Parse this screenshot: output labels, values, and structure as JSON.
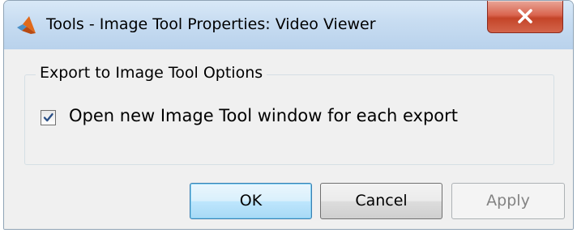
{
  "window": {
    "title": "Tools - Image Tool Properties: Video Viewer",
    "app_icon": "matlab-icon",
    "close_icon": "close-icon"
  },
  "group": {
    "title": "Export to Image Tool Options"
  },
  "checkbox": {
    "label": "Open new Image Tool window for each export",
    "checked": true
  },
  "buttons": {
    "ok_label": "OK",
    "cancel_label": "Cancel",
    "apply_label": "Apply",
    "apply_enabled": false
  },
  "colors": {
    "titlebar": "#c7dcf1",
    "close_button": "#c44428",
    "dialog_background": "#f0f0f0",
    "ok_border": "#3c7fb1"
  }
}
